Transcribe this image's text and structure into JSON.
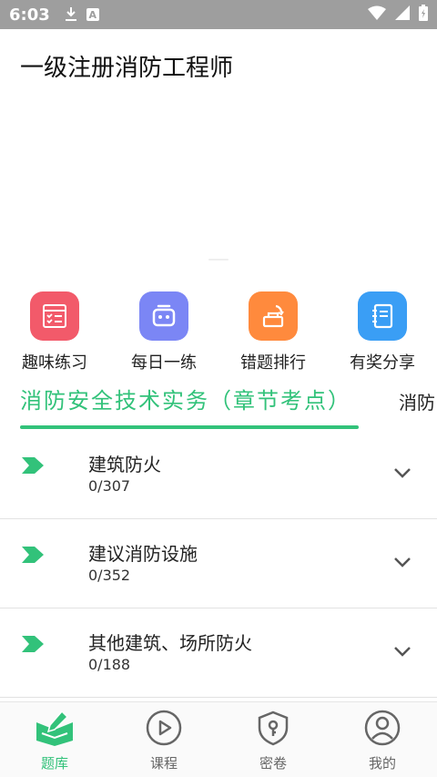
{
  "status_bar": {
    "time": "6:03",
    "icons": [
      "download-icon",
      "a-icon",
      "wifi-icon",
      "signal-icon",
      "battery-icon"
    ]
  },
  "header": {
    "title": "一级注册消防工程师"
  },
  "quick_actions": [
    {
      "label": "趣味练习",
      "icon": "checklist-icon",
      "color": "#f25a6a"
    },
    {
      "label": "每日一练",
      "icon": "robot-icon",
      "color": "#7b86f5"
    },
    {
      "label": "错题排行",
      "icon": "rank-icon",
      "color": "#ff8a3d"
    },
    {
      "label": "有奖分享",
      "icon": "notebook-icon",
      "color": "#3a9ef5"
    }
  ],
  "tabs": {
    "active": "消防安全技术实务（章节考点）",
    "next": "消防"
  },
  "chapters": [
    {
      "name": "建筑防火",
      "progress": "0/307"
    },
    {
      "name": "建议消防设施",
      "progress": "0/352"
    },
    {
      "name": "其他建筑、场所防火",
      "progress": "0/188"
    }
  ],
  "bottom_nav": [
    {
      "label": "题库",
      "icon": "book-pen-icon",
      "active": true
    },
    {
      "label": "课程",
      "icon": "play-circle-icon",
      "active": false
    },
    {
      "label": "密卷",
      "icon": "shield-lock-icon",
      "active": false
    },
    {
      "label": "我的",
      "icon": "user-icon",
      "active": false
    }
  ],
  "colors": {
    "accent": "#32c27a",
    "status_bar": "#9e9e9e"
  }
}
